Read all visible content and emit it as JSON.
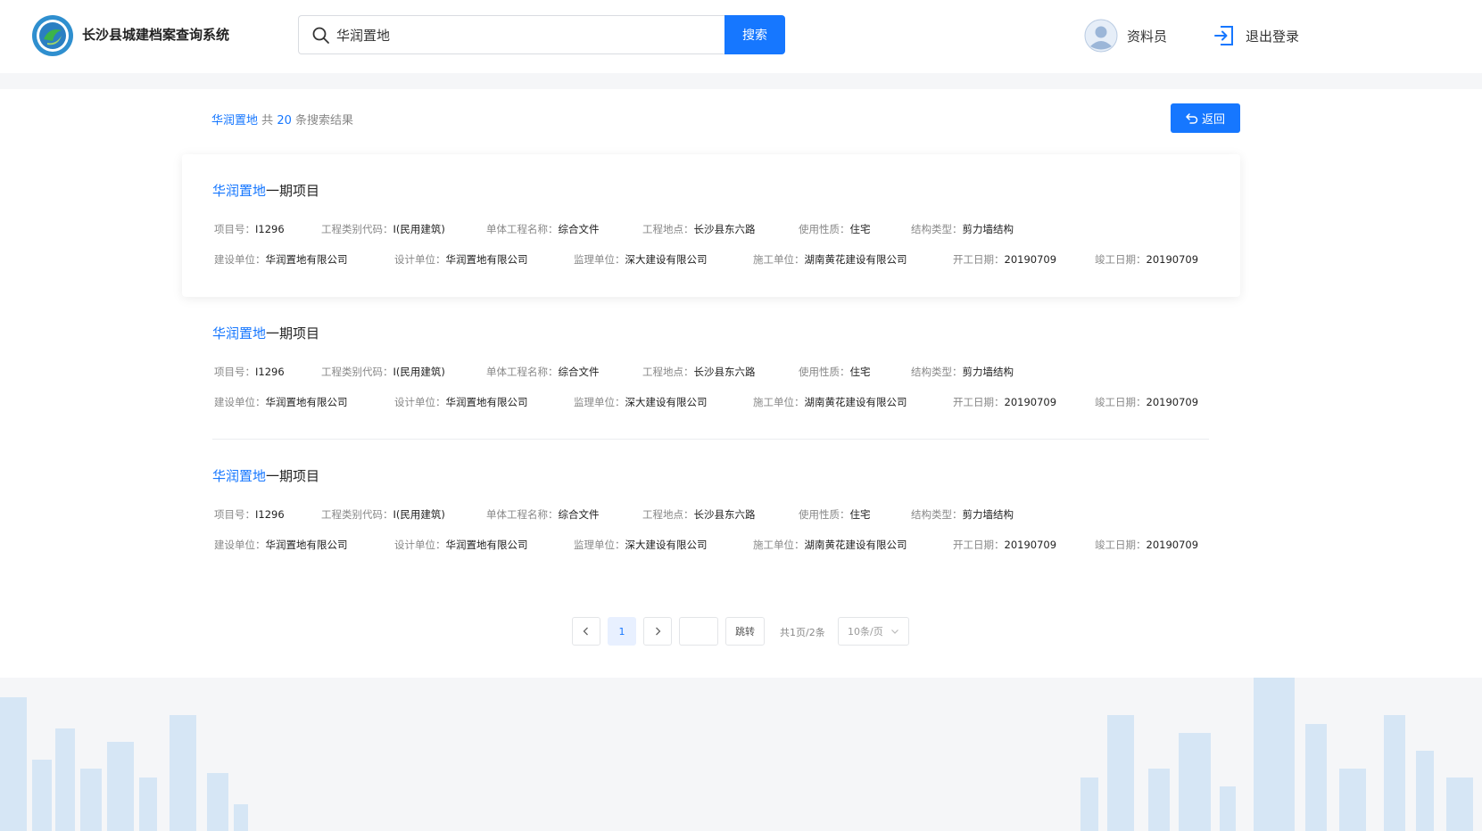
{
  "header": {
    "app_title": "长沙县城建档案查询系统",
    "search_value": "华润置地",
    "search_button": "搜索",
    "user_name": "资料员",
    "logout_label": "退出登录"
  },
  "summary": {
    "keyword": "华润置地",
    "prefix": "共",
    "count": "20",
    "suffix": "条搜索结果",
    "back_label": "返回"
  },
  "results": [
    {
      "title_keyword": "华润置地",
      "title_rest": "一期项目",
      "row1": [
        {
          "label": "项目号：",
          "value": "I1296"
        },
        {
          "label": "工程类别代码：",
          "value": "I(民用建筑)"
        },
        {
          "label": "单体工程名称：",
          "value": "综合文件"
        },
        {
          "label": "工程地点：",
          "value": "长沙县东六路"
        },
        {
          "label": "使用性质：",
          "value": "住宅"
        },
        {
          "label": "结构类型：",
          "value": "剪力墙结构"
        }
      ],
      "row2": [
        {
          "label": "建设单位：",
          "value": "华润置地有限公司"
        },
        {
          "label": "设计单位：",
          "value": "华润置地有限公司"
        },
        {
          "label": "监理单位：",
          "value": "深大建设有限公司"
        },
        {
          "label": "施工单位：",
          "value": "湖南黄花建设有限公司"
        },
        {
          "label": "开工日期：",
          "value": "20190709"
        },
        {
          "label": "竣工日期：",
          "value": "20190709"
        }
      ]
    },
    {
      "title_keyword": "华润置地",
      "title_rest": "一期项目",
      "row1": [
        {
          "label": "项目号：",
          "value": "I1296"
        },
        {
          "label": "工程类别代码：",
          "value": "I(民用建筑)"
        },
        {
          "label": "单体工程名称：",
          "value": "综合文件"
        },
        {
          "label": "工程地点：",
          "value": "长沙县东六路"
        },
        {
          "label": "使用性质：",
          "value": "住宅"
        },
        {
          "label": "结构类型：",
          "value": "剪力墙结构"
        }
      ],
      "row2": [
        {
          "label": "建设单位：",
          "value": "华润置地有限公司"
        },
        {
          "label": "设计单位：",
          "value": "华润置地有限公司"
        },
        {
          "label": "监理单位：",
          "value": "深大建设有限公司"
        },
        {
          "label": "施工单位：",
          "value": "湖南黄花建设有限公司"
        },
        {
          "label": "开工日期：",
          "value": "20190709"
        },
        {
          "label": "竣工日期：",
          "value": "20190709"
        }
      ]
    },
    {
      "title_keyword": "华润置地",
      "title_rest": "一期项目",
      "row1": [
        {
          "label": "项目号：",
          "value": "I1296"
        },
        {
          "label": "工程类别代码：",
          "value": "I(民用建筑)"
        },
        {
          "label": "单体工程名称：",
          "value": "综合文件"
        },
        {
          "label": "工程地点：",
          "value": "长沙县东六路"
        },
        {
          "label": "使用性质：",
          "value": "住宅"
        },
        {
          "label": "结构类型：",
          "value": "剪力墙结构"
        }
      ],
      "row2": [
        {
          "label": "建设单位：",
          "value": "华润置地有限公司"
        },
        {
          "label": "设计单位：",
          "value": "华润置地有限公司"
        },
        {
          "label": "监理单位：",
          "value": "深大建设有限公司"
        },
        {
          "label": "施工单位：",
          "value": "湖南黄花建设有限公司"
        },
        {
          "label": "开工日期：",
          "value": "20190709"
        },
        {
          "label": "竣工日期：",
          "value": "20190709"
        }
      ]
    }
  ],
  "pagination": {
    "current_page": "1",
    "jump_value": "",
    "jump_label": "跳转",
    "total_text": "共1页/2条",
    "page_size": "10条/页"
  },
  "icons": [
    "logo-icon",
    "search-icon",
    "avatar-icon",
    "logout-icon",
    "back-icon",
    "chevron-left-icon",
    "chevron-right-icon",
    "chevron-down-icon"
  ],
  "colors": {
    "accent": "#1677ff",
    "page_bg": "#f5f6f8"
  }
}
